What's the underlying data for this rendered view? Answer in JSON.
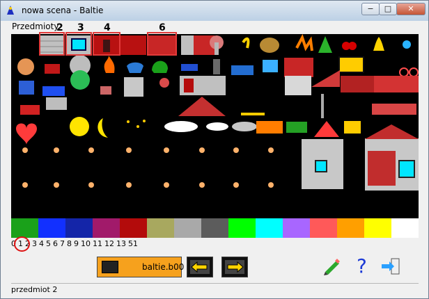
{
  "window": {
    "title": "nowa scena - Baltie"
  },
  "menu": {
    "label": "Przedmioty"
  },
  "markers": {
    "m2": "2",
    "m3": "3",
    "m4": "4",
    "m6": "6"
  },
  "scene": {
    "background": "#000000"
  },
  "palette": {
    "colors": [
      "#1aa11a",
      "#1230ff",
      "#1425a8",
      "#a11a6a",
      "#b30b0b",
      "#a8a85f",
      "#a9a9a9",
      "#5c5c5c",
      "#00ff00",
      "#00ffff",
      "#a866ff",
      "#ff5959",
      "#ff9f00",
      "#ffff00",
      "#ffffff"
    ]
  },
  "banks": {
    "labels": [
      "0",
      "1",
      "2",
      "3",
      "4",
      "5",
      "6",
      "7",
      "8",
      "9",
      "10",
      "11",
      "12",
      "13",
      "51"
    ],
    "selected": "0"
  },
  "toolbar": {
    "file_label": "baltie.b00"
  },
  "status": {
    "text": "przedmiot 2"
  },
  "icons": {
    "app": "baltie-app-icon",
    "grid": "grid-icon",
    "left": "arrow-left-icon",
    "right": "arrow-right-icon",
    "edit": "pencil-icon",
    "help": "help-icon",
    "exit": "exit-icon"
  }
}
